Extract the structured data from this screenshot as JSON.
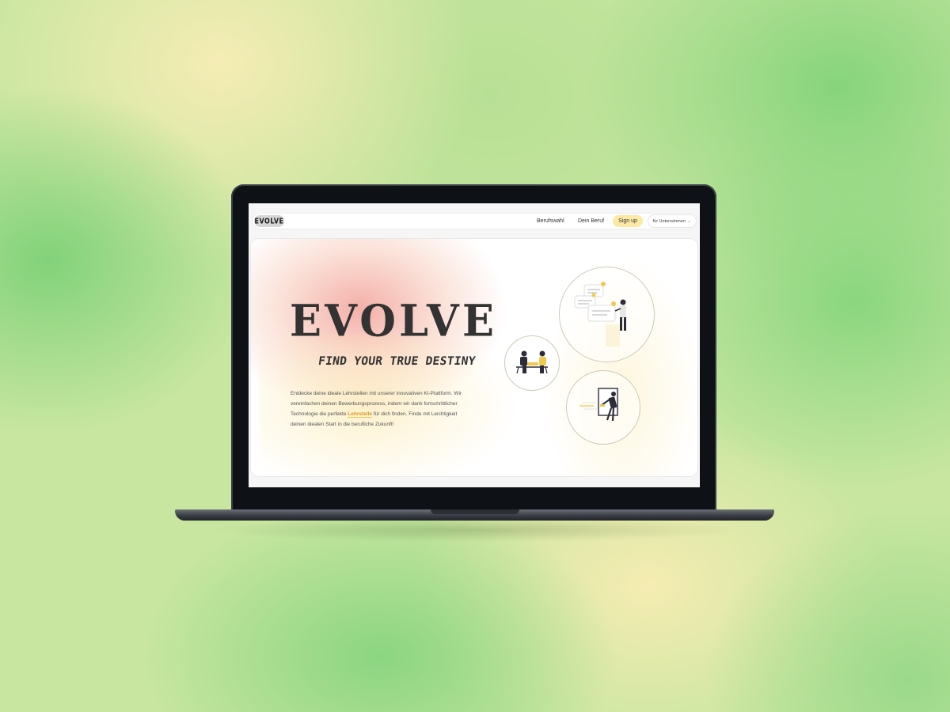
{
  "nav": {
    "logo": "EVOLVE",
    "links": [
      "Berufswahl",
      "Dein Beruf"
    ],
    "signup": "Sign up",
    "company": "für Unternehmen",
    "company_arrow": "→"
  },
  "hero": {
    "wordmark": "EVOLVE",
    "tagline": "FIND YOUR TRUE DESTINY",
    "description_before": "Entdecke deine ideale Lehrstellen mit unserer innovativen KI-Plattform. Wir vereinfachen deinen Bewerbungsprozess, indem wir dank fortschrittlicher Technologie die perfekte",
    "description_highlight": "Lehrstelle",
    "description_after": "für dich finden. Finde mit Leichtigkeit deinen idealen Start in die berufliche Zukunft!"
  },
  "illustrations": [
    "chat-bubbles-person-icon",
    "handshake-icon",
    "door-exit-person-icon"
  ],
  "colors": {
    "accent_yellow": "#fbe9a4",
    "highlight": "#d09a1d",
    "blob_red": "#f0968c"
  }
}
